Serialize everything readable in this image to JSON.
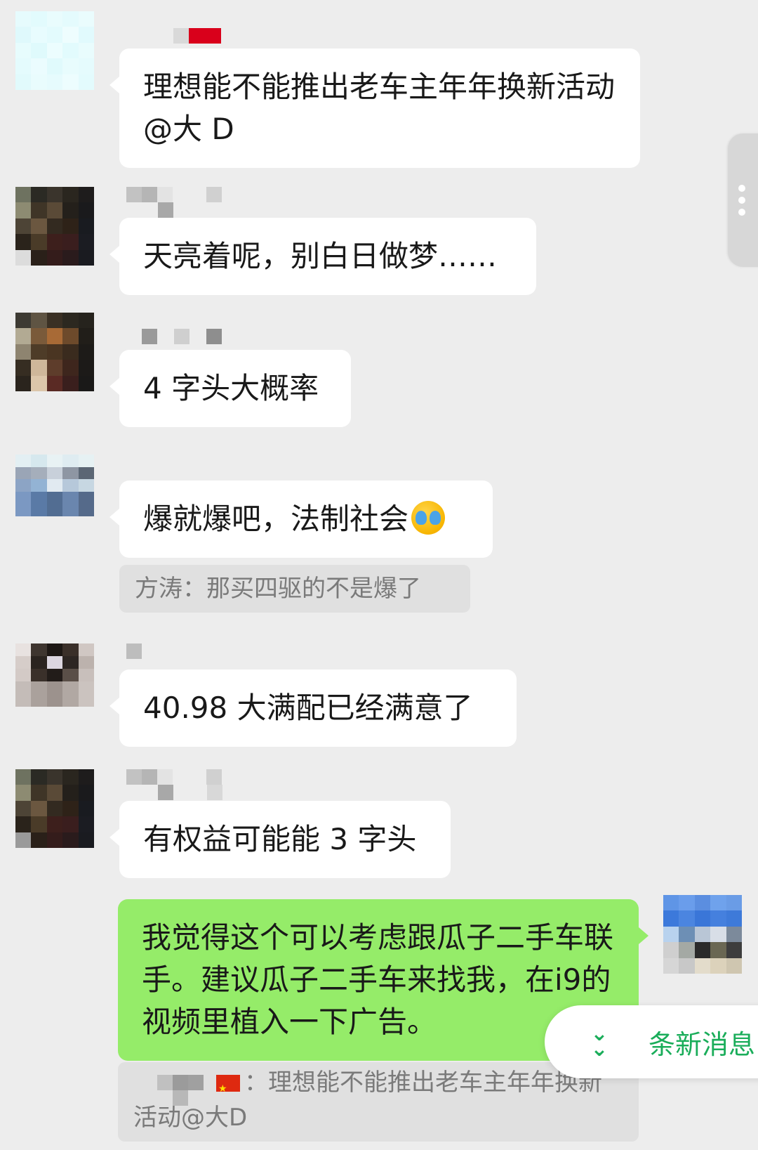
{
  "messages": [
    {
      "text": "理想能不能推出老车主年年换新活动@大 D"
    },
    {
      "text": "天亮着呢，别白日做梦……"
    },
    {
      "text": "4 字头大概率"
    },
    {
      "text": "爆就爆吧，法制社会",
      "emoji": "face-with-tears-of-joy",
      "quote": "方涛：那买四驱的不是爆了"
    },
    {
      "text": "40.98 大满配已经满意了"
    },
    {
      "text": "有权益可能能 3 字头"
    },
    {
      "text": "我觉得这个可以考虑跟瓜子二手车联手。建议瓜子二手车来找我，在i9的视频里植入一下广告。",
      "quote_prefix": "：",
      "quote": "理想能不能推出老车主年年换新活动@大D"
    }
  ],
  "new_messages_label": "条新消息",
  "new_messages_icon": "double-chevron-down-icon",
  "colors": {
    "background": "#ededed",
    "incoming_bubble": "#ffffff",
    "outgoing_bubble": "#95ec69",
    "accent": "#1aad5a"
  }
}
